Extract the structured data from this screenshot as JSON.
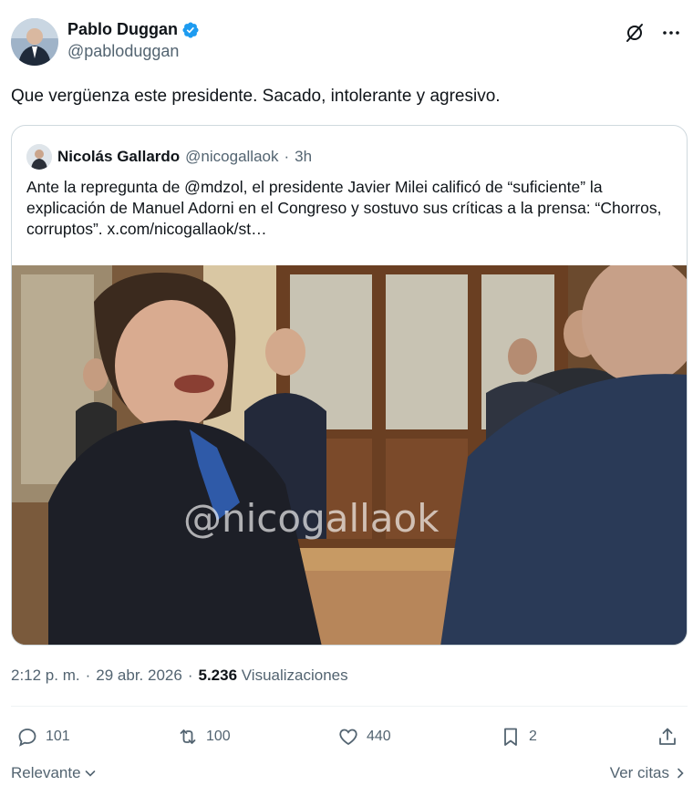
{
  "author": {
    "name": "Pablo Duggan",
    "handle": "@pabloduggan",
    "verified_color": "#1d9bf0"
  },
  "tweet": {
    "text": "Que vergüenza este presidente. Sacado, intolerante y agresivo."
  },
  "quote": {
    "name": "Nicolás Gallardo",
    "handle": "@nicogallaok",
    "separator": "·",
    "time": "3h",
    "text": "Ante la repregunta de @mdzol, el presidente Javier Milei calificó de “suficiente” la explicación de Manuel Adorni en el Congreso y sostuvo sus críticas a la prensa: “Chorros, corruptos”.  x.com/nicogallaok/st…",
    "media_watermark": "@nicogallaok"
  },
  "meta": {
    "time": "2:12 p. m.",
    "sep1": "·",
    "date": "29 abr. 2026",
    "sep2": "·",
    "views_count": "5.236",
    "views_label": "Visualizaciones"
  },
  "actions": {
    "replies": "101",
    "reposts": "100",
    "likes": "440",
    "bookmarks": "2"
  },
  "footer": {
    "sort_label": "Relevante",
    "quotes_label": "Ver citas"
  },
  "icons": {
    "verified": "verified-badge-icon",
    "grok": "grok-icon",
    "more": "more-icon",
    "reply": "reply-icon",
    "repost": "repost-icon",
    "like": "like-icon",
    "bookmark": "bookmark-icon",
    "share": "share-icon",
    "chevron_down": "chevron-down-icon",
    "chevron_right": "chevron-right-icon"
  }
}
